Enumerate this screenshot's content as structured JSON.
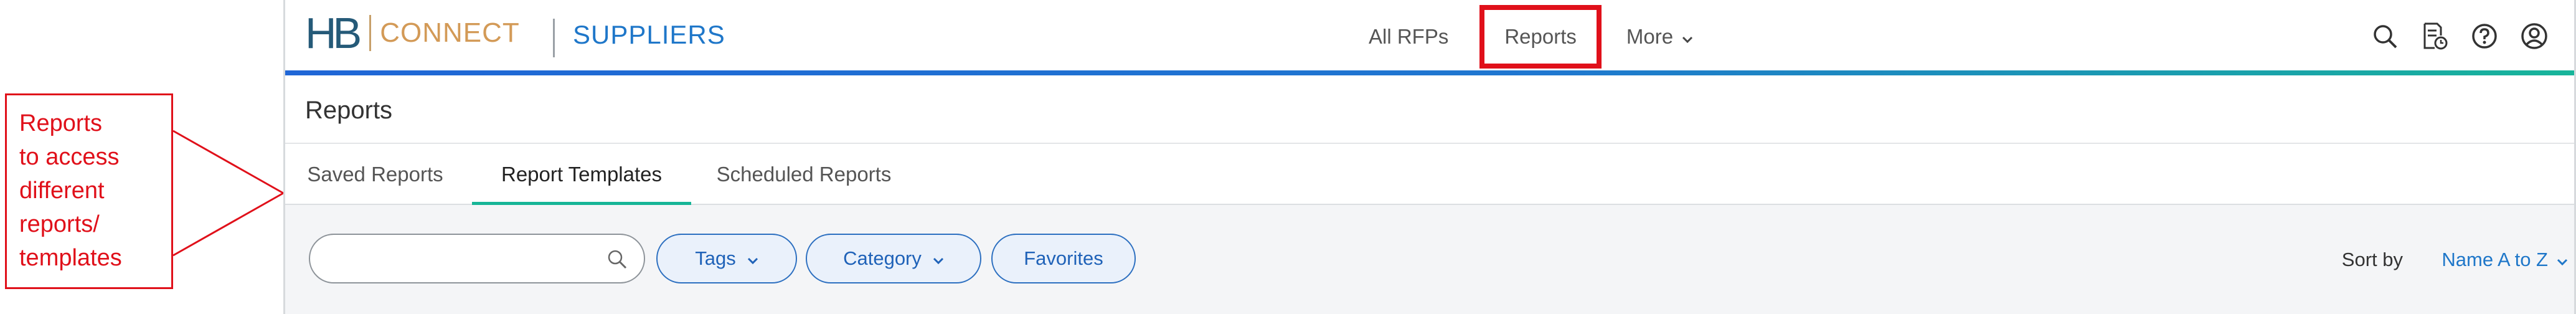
{
  "annotation": {
    "text": "Reports\nto access\ndifferent\nreports/\ntemplates",
    "color": "#e0101a"
  },
  "header": {
    "logo_hb": "HB",
    "logo_connect": "CONNECT",
    "app_name": "SUPPLIERS",
    "nav": [
      {
        "label": "All RFPs"
      },
      {
        "label": "Reports",
        "highlighted": true
      },
      {
        "label": "More",
        "has_dropdown": true
      }
    ],
    "icons": [
      "search-icon",
      "report-schedule-icon",
      "help-icon",
      "account-icon"
    ]
  },
  "page": {
    "title": "Reports"
  },
  "tabs": [
    {
      "label": "Saved Reports",
      "active": false
    },
    {
      "label": "Report Templates",
      "active": true
    },
    {
      "label": "Scheduled Reports",
      "active": false
    }
  ],
  "filters": {
    "search_value": "",
    "search_placeholder": "",
    "pills": [
      {
        "label": "Tags",
        "has_dropdown": true
      },
      {
        "label": "Category",
        "has_dropdown": true
      },
      {
        "label": "Favorites",
        "has_dropdown": false
      }
    ],
    "sort_label": "Sort by",
    "sort_value": "Name A to Z"
  },
  "colors": {
    "accent_blue": "#1f77c9",
    "accent_teal": "#17b597",
    "highlight_red": "#e0101a"
  }
}
